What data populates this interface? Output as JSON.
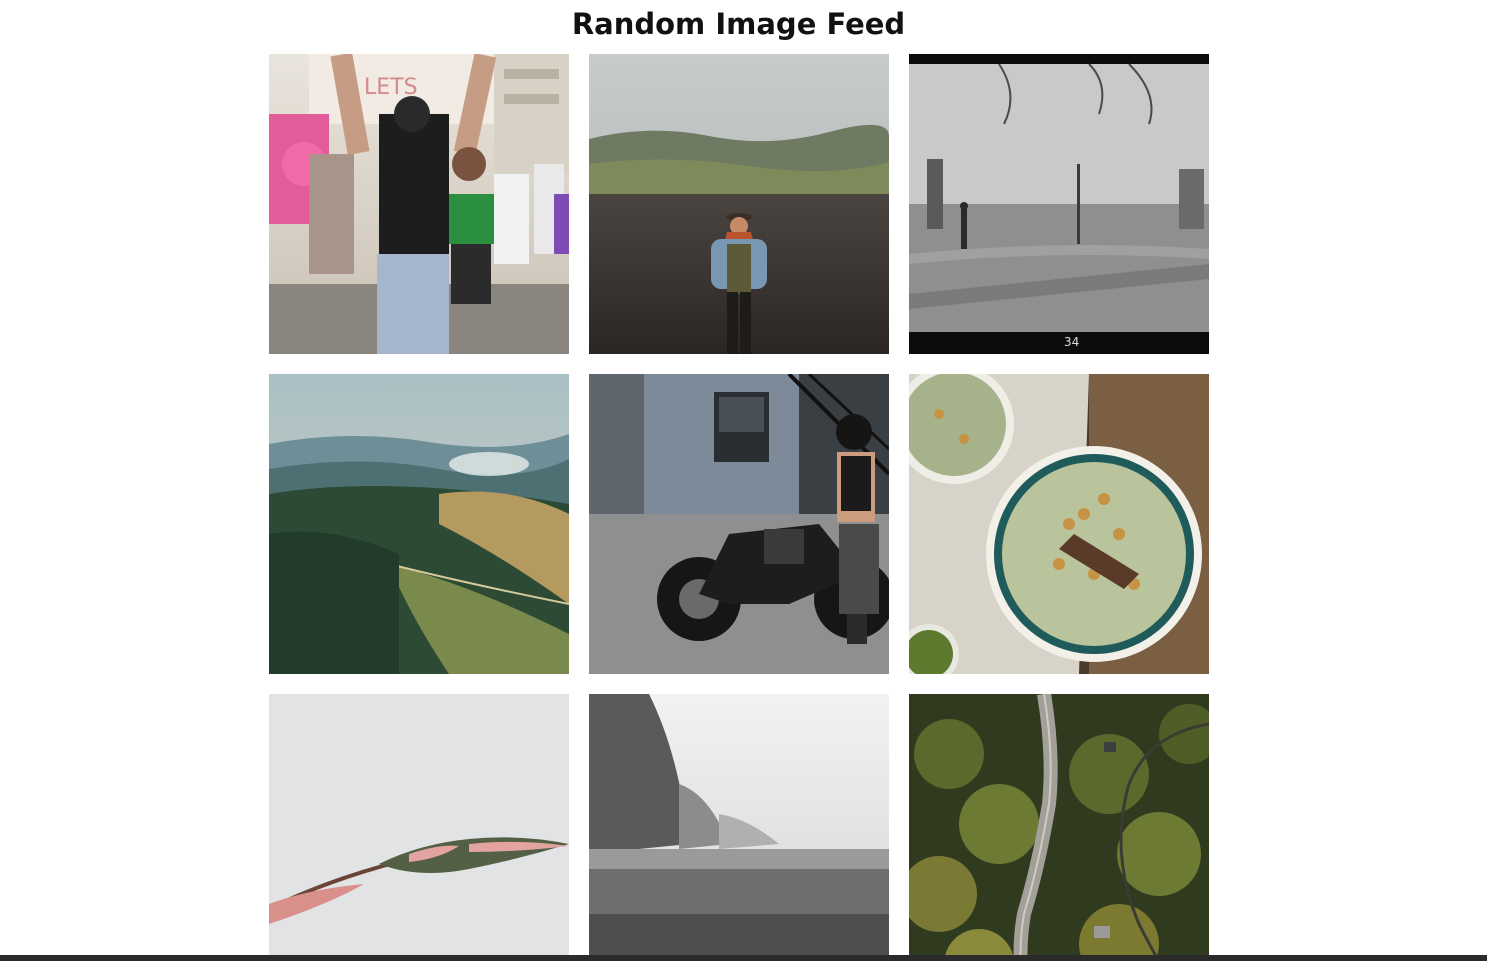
{
  "page": {
    "title": "Random Image Feed"
  },
  "feed": {
    "images": [
      {
        "subject": "street parade crowd"
      },
      {
        "subject": "woman in hat on dark field"
      },
      {
        "subject": "black and white ruined city"
      },
      {
        "subject": "foggy forested hills aerial"
      },
      {
        "subject": "motorcyclist beside brick building"
      },
      {
        "subject": "bowls of chickpea soup on wooden table"
      },
      {
        "subject": "pink leaf against pale sky"
      },
      {
        "subject": "misty cliffs black and white"
      },
      {
        "subject": "aerial road through forest"
      }
    ]
  },
  "colors": {
    "background": "#ffffff",
    "title": "#111111",
    "bottom_bar": "#2b2b2b"
  }
}
